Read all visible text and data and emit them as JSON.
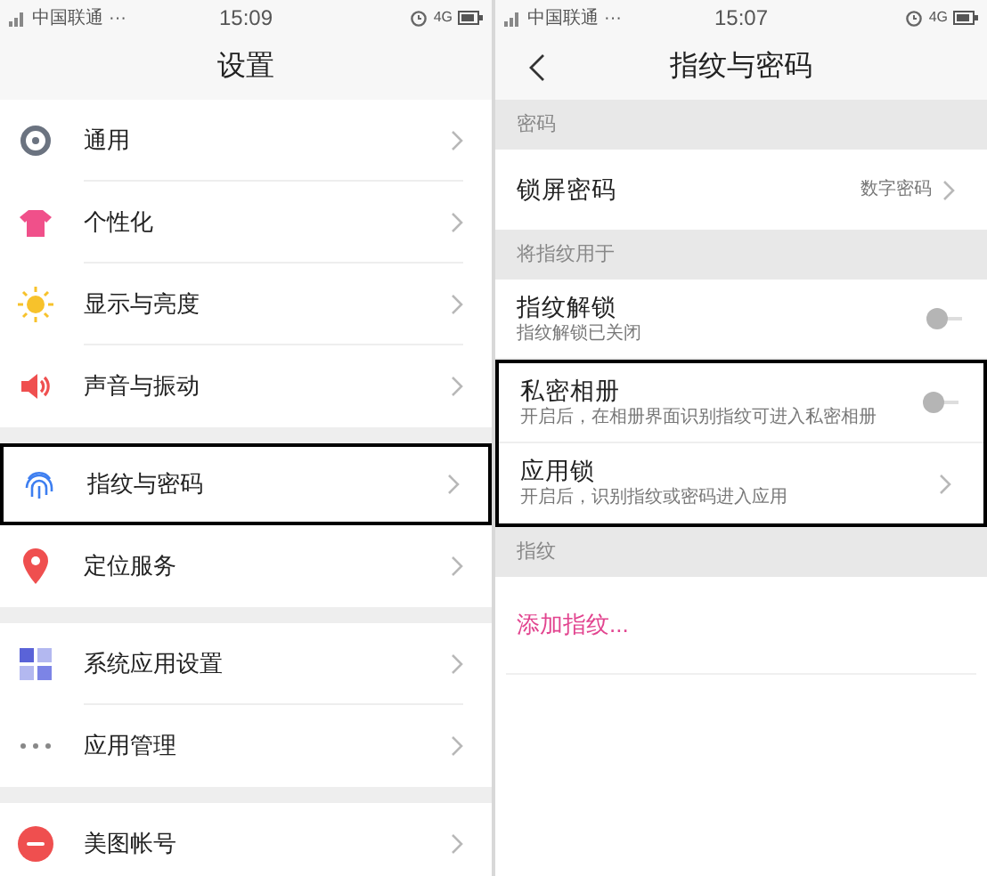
{
  "screens": [
    {
      "status_bar": {
        "carrier": "中国联通",
        "dots": "···",
        "time": "15:09",
        "network": "4G"
      },
      "title": "设置",
      "back": false,
      "groups": [
        {
          "items": [
            {
              "label": "通用",
              "highlighted": false
            },
            {
              "label": "个性化",
              "highlighted": false
            },
            {
              "label": "显示与亮度",
              "highlighted": false
            },
            {
              "label": "声音与振动",
              "highlighted": false
            }
          ]
        },
        {
          "items": [
            {
              "label": "指纹与密码",
              "highlighted": true
            },
            {
              "label": "定位服务",
              "highlighted": false
            }
          ]
        },
        {
          "items": [
            {
              "label": "系统应用设置",
              "highlighted": false
            },
            {
              "label": "应用管理",
              "highlighted": false
            }
          ]
        },
        {
          "items": [
            {
              "label": "美图帐号",
              "highlighted": false
            }
          ]
        }
      ]
    },
    {
      "status_bar": {
        "carrier": "中国联通",
        "dots": "···",
        "time": "15:07",
        "network": "4G"
      },
      "title": "指纹与密码",
      "back": true,
      "sections": [
        {
          "header": "密码",
          "rows": [
            {
              "kind": "link",
              "title": "锁屏密码",
              "value": "数字密码",
              "highlighted": false
            }
          ]
        },
        {
          "header": "将指纹用于",
          "rows": [
            {
              "kind": "toggle",
              "title": "指纹解锁",
              "subtitle": "指纹解锁已关闭",
              "on": false,
              "highlighted": false
            },
            {
              "kind": "toggle",
              "title": "私密相册",
              "subtitle": "开启后，在相册界面识别指纹可进入私密相册",
              "on": false,
              "highlighted": true
            },
            {
              "kind": "link",
              "title": "应用锁",
              "subtitle": "开启后，识别指纹或密码进入应用",
              "highlighted": true
            }
          ]
        },
        {
          "header": "指纹",
          "rows": [
            {
              "kind": "action",
              "title": "添加指纹..."
            }
          ]
        }
      ]
    }
  ]
}
